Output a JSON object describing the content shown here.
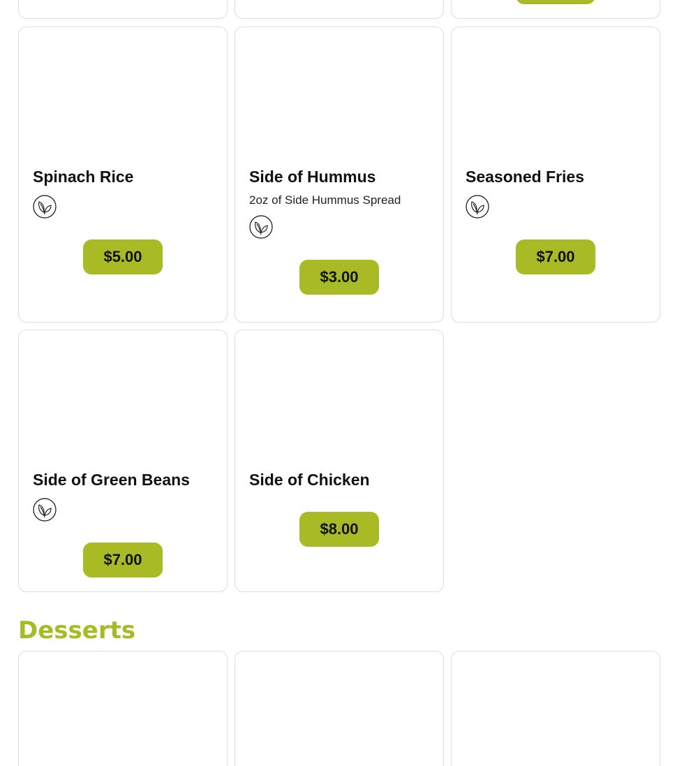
{
  "colors": {
    "accent": "#a8bb25",
    "card_border": "#dddddd",
    "text": "#111111"
  },
  "sides": {
    "items": [
      {
        "name": "Spinach Rice",
        "description": "",
        "vegetarian": true,
        "price": "$5.00"
      },
      {
        "name": "Side of Hummus",
        "description": "2oz of Side Hummus Spread",
        "vegetarian": true,
        "price": "$3.00"
      },
      {
        "name": "Seasoned Fries",
        "description": "",
        "vegetarian": true,
        "price": "$7.00"
      },
      {
        "name": "Side of Green Beans",
        "description": "",
        "vegetarian": true,
        "price": "$7.00"
      },
      {
        "name": "Side of Chicken",
        "description": "",
        "vegetarian": false,
        "price": "$8.00"
      }
    ]
  },
  "desserts": {
    "title": "Desserts"
  },
  "icons": {
    "vegetarian": "leaf-icon"
  }
}
